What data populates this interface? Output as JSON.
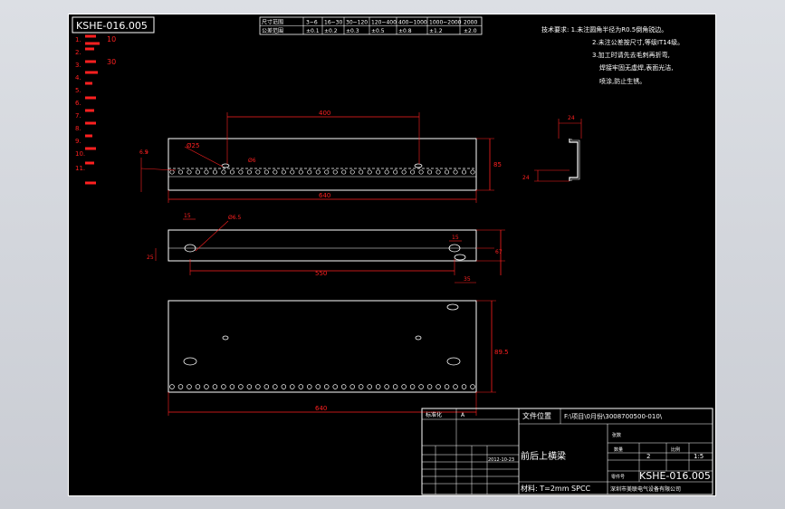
{
  "drawing": {
    "number": "KSHE-016.005",
    "title_block": {
      "part_name": "前后上横梁",
      "material": "材料:  T=2mm  SPCC",
      "file_location_label": "文件位置",
      "file_path": "F:\\项目\\0月份\\3008700500-010\\",
      "scale": "1:5",
      "company": "深圳市美联电气设备有限公司",
      "sheet_count": "2",
      "date": "2012-10-23",
      "mark": "A",
      "approval_label": "标准化",
      "label_sheets": "张数",
      "label_qty": "数量",
      "label_ratio": "比例",
      "label_part": "零件号"
    },
    "tolerance_table": {
      "headers": [
        "尺寸范围",
        "3~6",
        "16~30",
        "30~120",
        "120~400",
        "400~1000",
        "1000~2000",
        "2000"
      ],
      "values": [
        "公差范围",
        "±0.1",
        "±0.2",
        "±0.3",
        "±0.5",
        "±0.8",
        "±1.2",
        "±2.0"
      ]
    },
    "tech_notes": [
      "技术要求: 1.未注圆角半径为R0.5倒角锐边。",
      "2.未注公差按尺寸,等级IT14级。",
      "3.加工时请先去毛刺再折弯,",
      "焊接牢固无虚焊,表面光洁,",
      "喷涂,防止生锈。"
    ],
    "left_notes": [
      "1.",
      "2.",
      "3.",
      "4.",
      "5.",
      "6.",
      "7.",
      "8.",
      "9.",
      "10.",
      "11."
    ],
    "dimensions": {
      "top_spacing": "400",
      "top_length": "640",
      "top_height": "85",
      "top_hole": "Ø25",
      "top_left_offset": "6.5",
      "top_edge": "9",
      "small_hole": "Ø6",
      "mid_left": "15",
      "mid_hole": "Ø6.5",
      "mid_right": "15",
      "mid_span": "550",
      "mid_end": "35",
      "mid_height": "67",
      "mid_side": "25",
      "bot_length": "640",
      "bot_height": "89.5",
      "profile_top": "24",
      "profile_bottom": "24"
    }
  }
}
